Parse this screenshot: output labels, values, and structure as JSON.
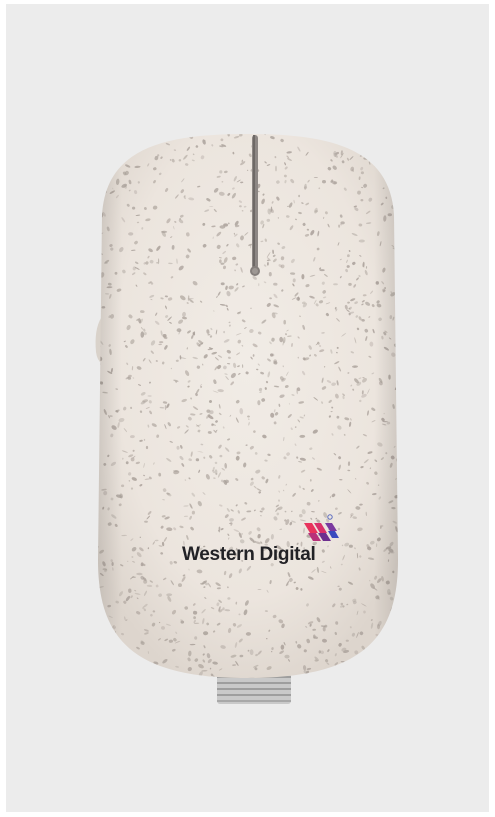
{
  "product": {
    "name": "wireless-mouse",
    "body_color": "#ece6df",
    "speckle_color": "#a89f98",
    "background_color": "#ececec"
  },
  "brand": {
    "wordmark": "Western Digital",
    "logo_icon": "western-digital-logo-icon",
    "logo_colors": [
      "#e8335c",
      "#6d2f8f",
      "#3a4bbf"
    ]
  }
}
